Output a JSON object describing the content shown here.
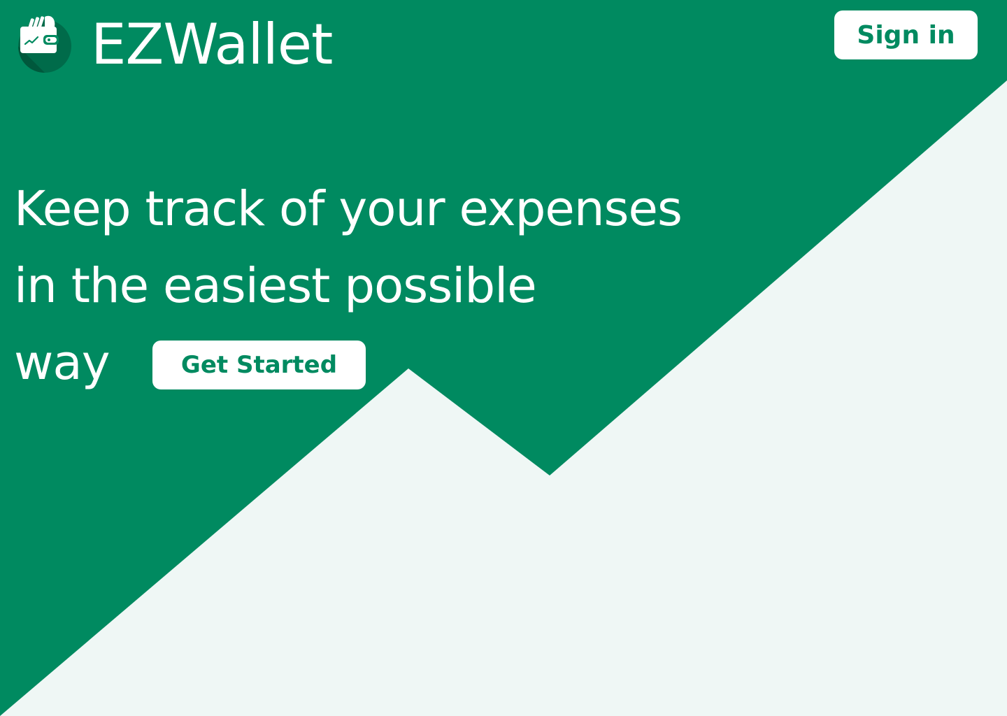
{
  "header": {
    "brand_name": "EZWallet",
    "logo_icon": "wallet-icon",
    "sign_in_label": "Sign in"
  },
  "hero": {
    "headline_lines": [
      "Keep track of your expenses",
      "in the easiest possible",
      "way"
    ],
    "cta_label": "Get Started"
  },
  "colors": {
    "brand_green": "#008a60",
    "dark_green": "#006b4a",
    "light_background": "#eff7f5",
    "white": "#ffffff"
  }
}
